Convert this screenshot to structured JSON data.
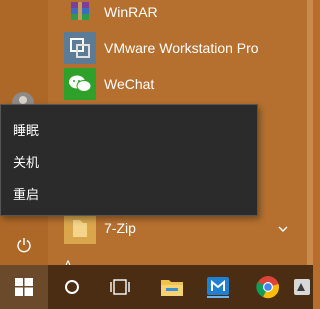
{
  "start_menu": {
    "apps": [
      {
        "label": "WinRAR",
        "icon": "winrar-icon"
      },
      {
        "label": "VMware Workstation Pro",
        "icon": "vmware-icon"
      },
      {
        "label": "WeChat",
        "icon": "wechat-icon"
      },
      {
        "label": "7-Zip",
        "icon": "folder-icon"
      }
    ],
    "letter_header": "A"
  },
  "power_menu": {
    "items": [
      {
        "label": "睡眠"
      },
      {
        "label": "关机"
      },
      {
        "label": "重启"
      }
    ]
  },
  "taskbar": {
    "items": [
      "start-icon",
      "cortana-icon",
      "task-view-icon",
      "file-explorer-icon",
      "maxthon-icon",
      "chrome-icon"
    ]
  },
  "colors": {
    "accent": "#b5702f",
    "menu_background": "#2b2b2b",
    "taskbar": "#4a2d12"
  }
}
